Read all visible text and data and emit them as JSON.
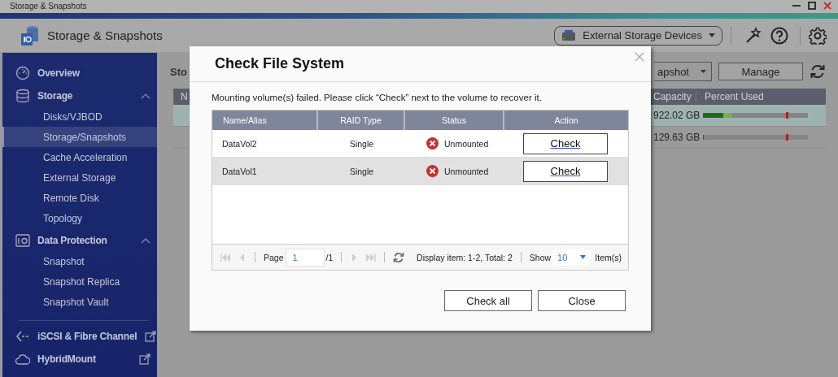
{
  "window": {
    "title": "Storage & Snapshots"
  },
  "header": {
    "app_title": "Storage & Snapshots",
    "device_dropdown": "External Storage Devices"
  },
  "sidebar": {
    "items": [
      {
        "label": "Overview",
        "selected": false
      },
      {
        "label": "Storage",
        "selected": false,
        "expanded": true,
        "children": [
          {
            "label": "Disks/VJBOD",
            "selected": false
          },
          {
            "label": "Storage/Snapshots",
            "selected": true
          },
          {
            "label": "Cache Acceleration",
            "selected": false
          },
          {
            "label": "External Storage",
            "selected": false
          },
          {
            "label": "Remote Disk",
            "selected": false
          },
          {
            "label": "Topology",
            "selected": false
          }
        ]
      },
      {
        "label": "Data Protection",
        "selected": false,
        "expanded": true,
        "children": [
          {
            "label": "Snapshot",
            "selected": false
          },
          {
            "label": "Snapshot Replica",
            "selected": false
          },
          {
            "label": "Snapshot Vault",
            "selected": false
          }
        ]
      },
      {
        "label": "iSCSI & Fibre Channel",
        "selected": false,
        "external": true
      },
      {
        "label": "HybridMount",
        "selected": false,
        "external": true
      }
    ]
  },
  "content": {
    "heading": "Sto",
    "snapshot_dropdown": "apshot",
    "manage_button": "Manage",
    "table": {
      "columns": [
        "N",
        "Capacity",
        "Percent Used"
      ],
      "rows": [
        {
          "capacity": "922.02 GB",
          "level": 0.28,
          "selected": true
        },
        {
          "capacity": "129.63 GB",
          "level": 0.01,
          "selected": false
        }
      ]
    }
  },
  "dialog": {
    "title": "Check File System",
    "message": "Mounting volume(s) failed. Please click “Check” next to the volume to recover it.",
    "table": {
      "columns": [
        "Name/Alias",
        "RAID Type",
        "Status",
        "Action"
      ],
      "rows": [
        {
          "name": "DataVol2",
          "raid_type": "Single",
          "status": "Unmounted",
          "action": "Check",
          "selected": false
        },
        {
          "name": "DataVol1",
          "raid_type": "Single",
          "status": "Unmounted",
          "action": "Check",
          "selected": true
        }
      ]
    },
    "pager": {
      "navigation_disabled": true,
      "page_label": "Page",
      "page": "1",
      "page_total": "/1",
      "display": "Display item: 1-2, Total: 2",
      "show_label": "Show",
      "page_size": "10",
      "items_label": "Item(s)"
    },
    "buttons": [
      "Check all",
      "Close"
    ]
  }
}
